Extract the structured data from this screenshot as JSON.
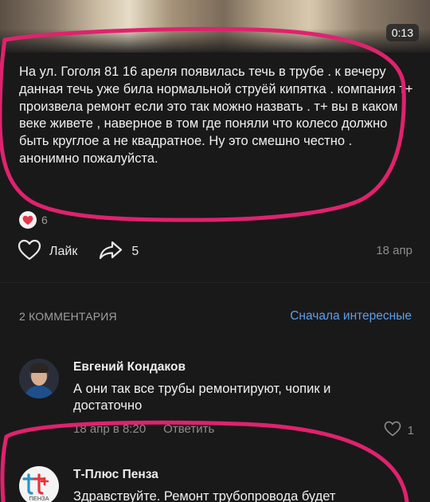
{
  "video": {
    "duration": "0:13"
  },
  "post": {
    "text": "На ул. Гоголя 81 16 ареля появилась течь в трубе . к вечеру данная течь уже била нормальной струёй кипятка . компания т+ произвела ремонт если это так можно назвать . т+ вы в каком веке живете , наверное в том где поняли что колесо должно быть круглое а не квадратное. Ну это смешно честно . анонимно пожалуйста.",
    "reaction_count": "6",
    "like_label": "Лайк",
    "share_count": "5",
    "date": "18 апр"
  },
  "comments_section": {
    "count_label": "2 КОММЕНТАРИЯ",
    "sort_label": "Сначала интересные"
  },
  "comments": [
    {
      "author": "Евгений Кондаков",
      "text": "А они так все трубы ремонтируют, чопик и достаточно",
      "date": "18 апр в 8:20",
      "reply_label": "Ответить",
      "likes": "1"
    },
    {
      "author": "Т-Плюс Пенза",
      "text": "Здравствуйте. Ремонт трубопровода будет",
      "avatar_text": "ПЕНЗА"
    }
  ],
  "colors": {
    "background": "#19191a",
    "accent": "#5e9ee6",
    "annotation": "#e0226e",
    "reaction": "#e8354c"
  }
}
